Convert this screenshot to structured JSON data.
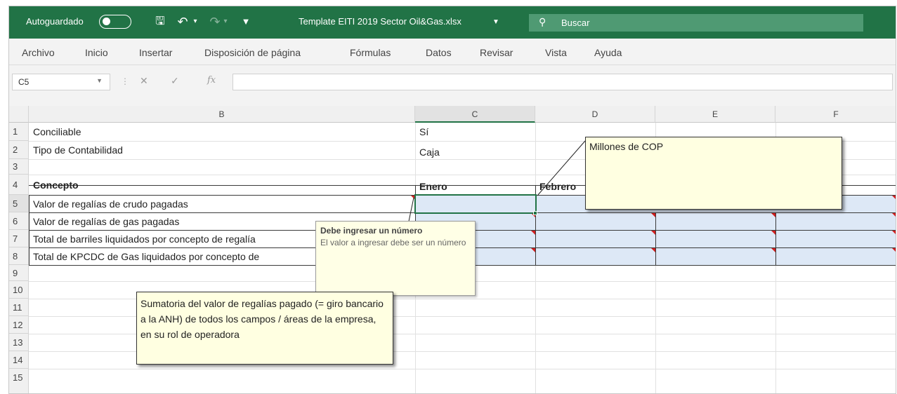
{
  "titlebar": {
    "autosave_label": "Autoguardado",
    "document_title": "Template EITI 2019 Sector Oil&Gas.xlsx",
    "search_placeholder": "Buscar"
  },
  "ribbon": {
    "tabs": [
      "Archivo",
      "Inicio",
      "Insertar",
      "Disposición de página",
      "Fórmulas",
      "Datos",
      "Revisar",
      "Vista",
      "Ayuda"
    ]
  },
  "formula_bar": {
    "name_box": "C5",
    "fx_symbol": "fx",
    "content": ""
  },
  "grid": {
    "columns": [
      "B",
      "C",
      "D",
      "E",
      "F"
    ],
    "rows": [
      "1",
      "2",
      "3",
      "4",
      "5",
      "6",
      "7",
      "8",
      "9",
      "10",
      "11",
      "12",
      "13",
      "14",
      "15"
    ],
    "active_cell": "C5",
    "cells": {
      "B1": "Conciliable",
      "C1": "Sí",
      "B2": "Tipo de Contabilidad",
      "C2": "Caja",
      "B4": "Concepto",
      "C4": "Enero",
      "D4": "Febrero",
      "B5": "Valor de regalías de crudo pagadas",
      "B6": "Valor de regalías de gas pagadas",
      "B7": "Total de barriles liquidados por concepto de regalía",
      "B8": "Total de KPCDC de Gas liquidados por concepto de"
    }
  },
  "notes": {
    "unit_note": "Millones de COP",
    "sum_note": "Sumatoria del valor de regalías pagado (= giro bancario a la ANH) de todos los campos / áreas de la empresa, en su rol de operadora"
  },
  "validation_tooltip": {
    "title": "Debe ingresar un número",
    "message": "El valor a ingresar debe ser un número"
  },
  "colors": {
    "excel_green": "#217346",
    "input_fill": "#dde8f6",
    "comment_fill": "#ffffe1",
    "indicator_red": "#d21f1f"
  }
}
